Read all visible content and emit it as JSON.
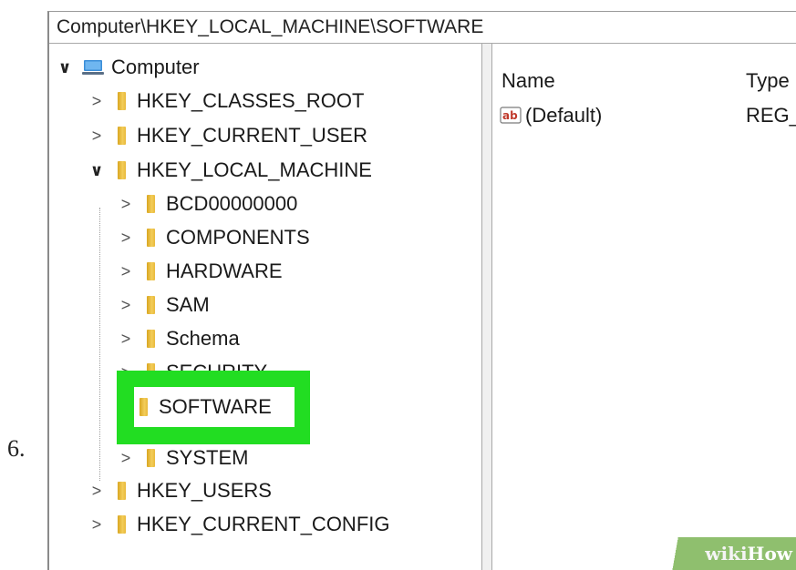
{
  "step_number": "6.",
  "address_bar": {
    "path": "Computer\\HKEY_LOCAL_MACHINE\\SOFTWARE"
  },
  "tree": {
    "root": {
      "label": "Computer",
      "icon": "computer-icon",
      "expanded": true
    },
    "hives": [
      {
        "label": "HKEY_CLASSES_ROOT",
        "expanded": false
      },
      {
        "label": "HKEY_CURRENT_USER",
        "expanded": false
      },
      {
        "label": "HKEY_LOCAL_MACHINE",
        "expanded": true
      },
      {
        "label": "HKEY_USERS",
        "expanded": false
      },
      {
        "label": "HKEY_CURRENT_CONFIG",
        "expanded": false
      }
    ],
    "hklm_children": [
      {
        "label": "BCD00000000"
      },
      {
        "label": "COMPONENTS"
      },
      {
        "label": "HARDWARE"
      },
      {
        "label": "SAM"
      },
      {
        "label": "Schema"
      },
      {
        "label": "SECURITY"
      },
      {
        "label": "SOFTWARE",
        "selected": true
      },
      {
        "label": "SYSTEM"
      }
    ]
  },
  "list": {
    "columns": [
      "Name",
      "Type"
    ],
    "rows": [
      {
        "name": "(Default)",
        "type": "REG_SZ",
        "icon": "string-value-icon"
      }
    ]
  },
  "highlight": {
    "color": "#22dd22"
  },
  "watermark": {
    "wiki": "wiki",
    "how": "How"
  }
}
